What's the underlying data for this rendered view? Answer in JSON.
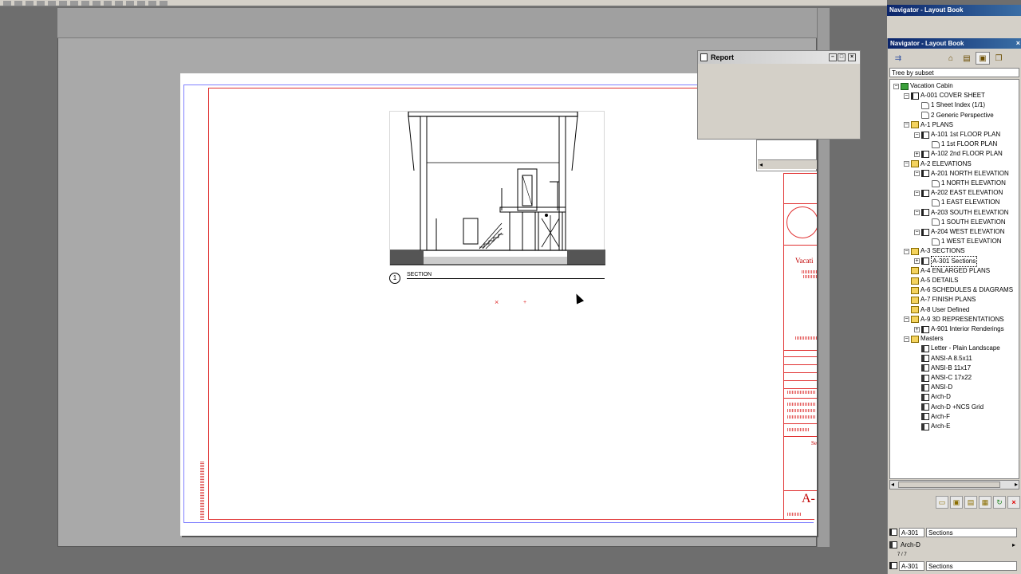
{
  "navigator_header_top": "Navigator - Layout Book",
  "navigator": {
    "title": "Navigator - Layout Book",
    "close": "×",
    "tree_mode": "Tree by subset",
    "tree": [
      {
        "label": "Vacation Cabin",
        "level": 0,
        "icon": "root",
        "exp": "−"
      },
      {
        "label": "A-001 COVER SHEET",
        "level": 1,
        "icon": "sheet",
        "exp": "−"
      },
      {
        "label": "1 Sheet Index (1/1)",
        "level": 2,
        "icon": "view",
        "exp": ""
      },
      {
        "label": "2 Generic Perspective",
        "level": 2,
        "icon": "view",
        "exp": ""
      },
      {
        "label": "A-1 PLANS",
        "level": 1,
        "icon": "folder",
        "exp": "−"
      },
      {
        "label": "A-101 1st FLOOR PLAN",
        "level": 2,
        "icon": "sheet",
        "exp": "−"
      },
      {
        "label": "1 1st FLOOR PLAN",
        "level": 3,
        "icon": "view",
        "exp": ""
      },
      {
        "label": "A-102 2nd FLOOR PLAN",
        "level": 2,
        "icon": "sheet",
        "exp": "+"
      },
      {
        "label": "A-2 ELEVATIONS",
        "level": 1,
        "icon": "folder",
        "exp": "−"
      },
      {
        "label": "A-201 NORTH ELEVATION",
        "level": 2,
        "icon": "sheet",
        "exp": "−"
      },
      {
        "label": "1 NORTH ELEVATION",
        "level": 3,
        "icon": "view",
        "exp": ""
      },
      {
        "label": "A-202 EAST ELEVATION",
        "level": 2,
        "icon": "sheet",
        "exp": "−"
      },
      {
        "label": "1 EAST ELEVATION",
        "level": 3,
        "icon": "view",
        "exp": ""
      },
      {
        "label": "A-203 SOUTH ELEVATION",
        "level": 2,
        "icon": "sheet",
        "exp": "−"
      },
      {
        "label": "1 SOUTH ELEVATION",
        "level": 3,
        "icon": "view",
        "exp": ""
      },
      {
        "label": "A-204 WEST ELEVATION",
        "level": 2,
        "icon": "sheet",
        "exp": "−"
      },
      {
        "label": "1 WEST ELEVATION",
        "level": 3,
        "icon": "view",
        "exp": ""
      },
      {
        "label": "A-3 SECTIONS",
        "level": 1,
        "icon": "folder",
        "exp": "−"
      },
      {
        "label": "A-301 Sections",
        "level": 2,
        "icon": "sheet",
        "exp": "+",
        "selected": true
      },
      {
        "label": "A-4 ENLARGED PLANS",
        "level": 1,
        "icon": "folder",
        "exp": ""
      },
      {
        "label": "A-5 DETAILS",
        "level": 1,
        "icon": "folder",
        "exp": ""
      },
      {
        "label": "A-6 SCHEDULES & DIAGRAMS",
        "level": 1,
        "icon": "folder",
        "exp": ""
      },
      {
        "label": "A-7 FINISH PLANS",
        "level": 1,
        "icon": "folder",
        "exp": ""
      },
      {
        "label": "A-8 User Defined",
        "level": 1,
        "icon": "folder",
        "exp": ""
      },
      {
        "label": "A-9 3D REPRESENTATIONS",
        "level": 1,
        "icon": "folder",
        "exp": "−"
      },
      {
        "label": "A-901 Interior Renderings",
        "level": 2,
        "icon": "sheet",
        "exp": "+"
      },
      {
        "label": "Masters",
        "level": 1,
        "icon": "folder",
        "exp": "−"
      },
      {
        "label": "Letter - Plain Landscape",
        "level": 2,
        "icon": "master",
        "exp": ""
      },
      {
        "label": "ANSI-A 8.5x11",
        "level": 2,
        "icon": "master",
        "exp": ""
      },
      {
        "label": "ANSI-B 11x17",
        "level": 2,
        "icon": "master",
        "exp": ""
      },
      {
        "label": "ANSI-C 17x22",
        "level": 2,
        "icon": "master",
        "exp": ""
      },
      {
        "label": "ANSI-D",
        "level": 2,
        "icon": "master",
        "exp": ""
      },
      {
        "label": "Arch-D",
        "level": 2,
        "icon": "master",
        "exp": ""
      },
      {
        "label": "Arch-D +NCS Grid",
        "level": 2,
        "icon": "master",
        "exp": ""
      },
      {
        "label": "Arch-F",
        "level": 2,
        "icon": "master",
        "exp": ""
      },
      {
        "label": "Arch-E",
        "level": 2,
        "icon": "master",
        "exp": ""
      }
    ],
    "fields": {
      "sheet_id": "A-301",
      "sheet_name": "Sections",
      "master": "Arch-D",
      "row3_small": "7 / 7",
      "bottom_id": "A-301",
      "bottom_name": "Sections"
    }
  },
  "report": {
    "title": "Report"
  },
  "sheet": {
    "section_number": "1",
    "section_label": "SECTION",
    "titleblock_project": "Vacati",
    "titleblock_sheet": "A-",
    "titleblock_small": "Se"
  },
  "colors": {
    "accent_red": "#e03030",
    "title_bar_blue": "#0a246a"
  }
}
